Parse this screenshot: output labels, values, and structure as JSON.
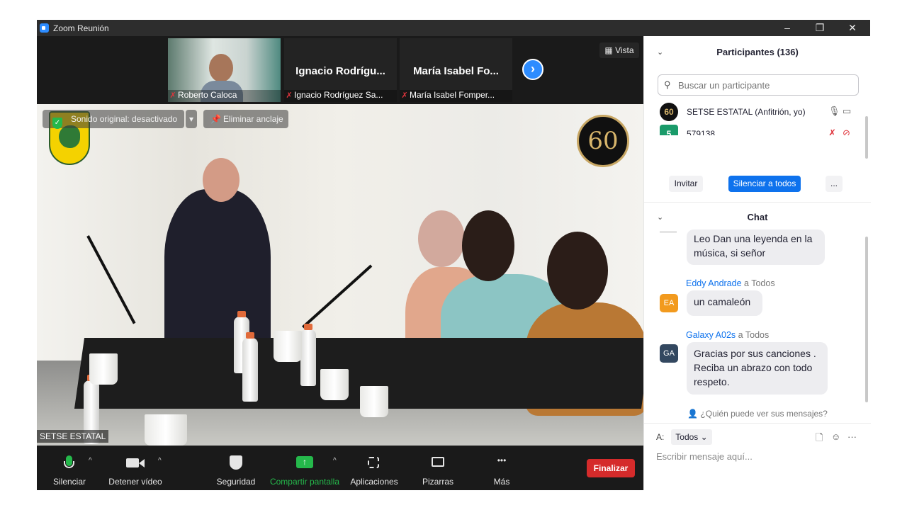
{
  "window": {
    "title": "Zoom Reunión",
    "minimize_label": "–",
    "restore_label": "❐",
    "close_label": "✕"
  },
  "video": {
    "view_label": "Vista",
    "thumbnails": [
      {
        "name": "",
        "caption": "Roberto Caloca"
      },
      {
        "name": "Ignacio  Rodrígu...",
        "caption": "Ignacio Rodríguez Sa..."
      },
      {
        "name": "María  Isabel Fo...",
        "caption": "María Isabel Fomper..."
      }
    ],
    "next_label": "›",
    "original_sound": "Sonido original: desactivado",
    "unpin": "Eliminar anclaje",
    "logo_text": "60",
    "speaker_label": "SETSE ESTATAL"
  },
  "toolbar": {
    "mute": "Silenciar",
    "stop_video": "Detener vídeo",
    "security": "Seguridad",
    "share": "Compartir pantalla",
    "apps": "Aplicaciones",
    "whiteboards": "Pizarras",
    "more": "Más",
    "end": "Finalizar",
    "more_icon": "•••",
    "caret": "^"
  },
  "participants": {
    "header": "Participantes (136)",
    "search_placeholder": "Buscar un participante",
    "rows": [
      {
        "avatar": "60",
        "name": "SETSE ESTATAL (Anfitrión, yo)"
      },
      {
        "avatar": "5",
        "name": "579138"
      }
    ],
    "invite": "Invitar",
    "mute_all": "Silenciar a todos",
    "more": "..."
  },
  "chat": {
    "header": "Chat",
    "messages": [
      {
        "sender": "",
        "to": "",
        "avatar": "",
        "text": "Leo Dan una leyenda en la música, si señor"
      },
      {
        "sender": "Eddy Andrade",
        "to": "a Todos",
        "avatar": "EA",
        "text": "un camaleón"
      },
      {
        "sender": "Galaxy A02s",
        "to": "a Todos",
        "avatar": "GA",
        "text": "Gracias por sus canciones . Reciba un abrazo con todo respeto."
      }
    ],
    "who_can_see": "¿Quién puede ver sus mensajes?",
    "to_label": "A:",
    "to_value": "Todos",
    "compose_placeholder": "Escribir mensaje aquí...",
    "more_icon": "···"
  },
  "colors": {
    "accent": "#0e72ed",
    "end": "#d52b2b",
    "share_green": "#25b84b"
  }
}
